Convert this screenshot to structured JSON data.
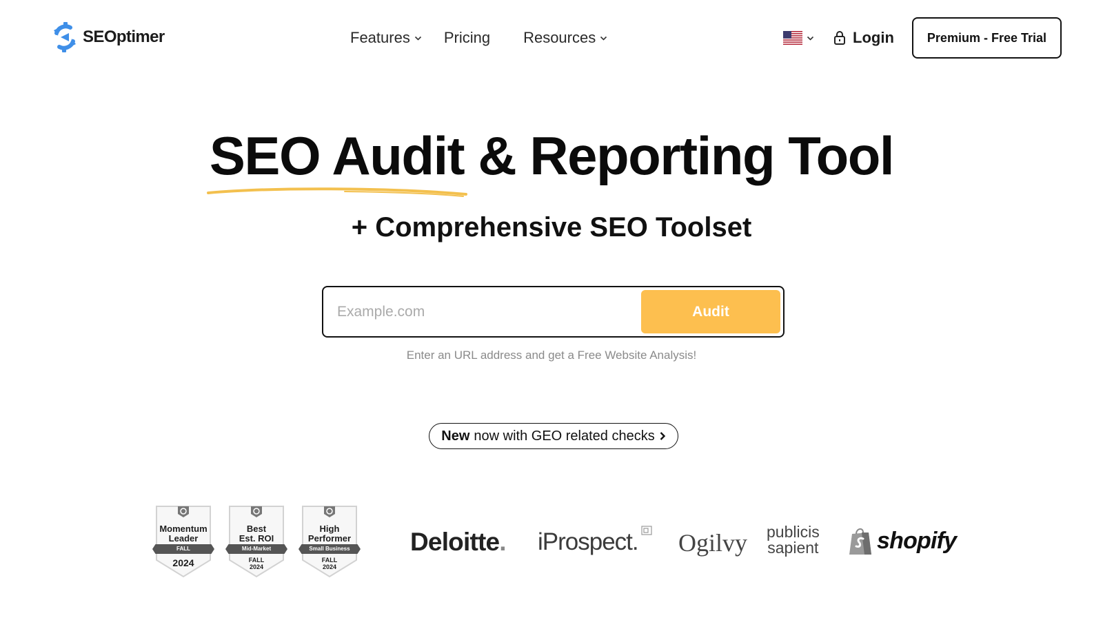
{
  "brand": {
    "name": "SEOptimer"
  },
  "nav": {
    "features": "Features",
    "pricing": "Pricing",
    "resources": "Resources",
    "language_icon": "us-flag-icon",
    "login": "Login",
    "premium_trial": "Premium - Free Trial"
  },
  "hero": {
    "title": "SEO Audit & Reporting Tool",
    "subtitle": "+ Comprehensive SEO Toolset"
  },
  "search": {
    "placeholder": "Example.com",
    "value": "",
    "button": "Audit",
    "helper": "Enter an URL address and get a Free Website Analysis!"
  },
  "announcement": {
    "badge": "New",
    "text": "now with GEO related checks"
  },
  "badges": [
    {
      "line1": "Momentum",
      "line2": "Leader",
      "ribbon": "FALL",
      "year": "2024"
    },
    {
      "line1": "Best",
      "line2": "Est. ROI",
      "ribbon": "Mid-Market",
      "season": "FALL",
      "year": "2024"
    },
    {
      "line1": "High",
      "line2": "Performer",
      "ribbon": "Small Business",
      "season": "FALL",
      "year": "2024"
    }
  ],
  "clients": {
    "deloitte": "Deloitte",
    "deloitte_dot": ".",
    "iprospect": "iProspect.",
    "ogilvy": "Ogilvy",
    "publicis_line1": "publicis",
    "publicis_line2": "sapient",
    "shopify": "shopify"
  },
  "colors": {
    "accent": "#fdbf4f",
    "logo_blue": "#3f8fe8",
    "underline": "#f3c04e",
    "text": "#0b0b0b",
    "muted": "#8a8a8a"
  }
}
